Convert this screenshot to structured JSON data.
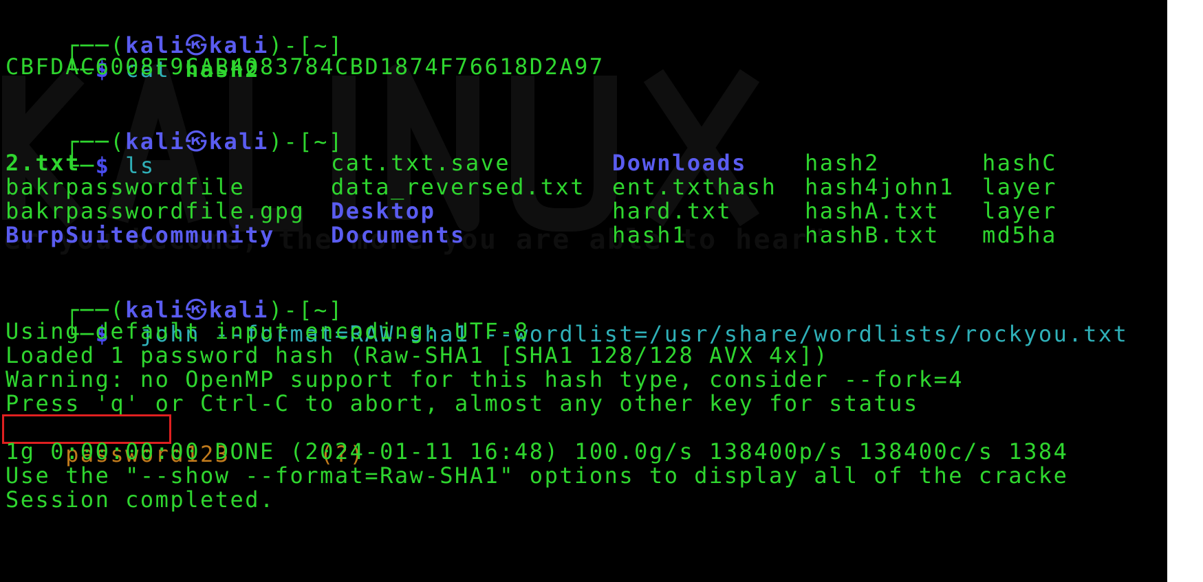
{
  "terminal": {
    "background": "#000000",
    "text_color": "#2fd62f",
    "accent_color": "#5a5cf0",
    "highlight_color": "#e02020",
    "cracked_color": "#c07a1c"
  },
  "prompt": {
    "frame_top": "┌──(",
    "user": "kali",
    "at_icon": "㉿",
    "host": "kali",
    "dir_part": ")-[~]",
    "frame_bottom": "└─",
    "dollar": "$"
  },
  "block1": {
    "cmd": "cat",
    "arg": "hash2",
    "output": "CBFDAC6008F9CAB4083784CBD1874F76618D2A97"
  },
  "block2": {
    "cmd": "ls",
    "columns": [
      [
        "2.txt",
        "bakrpasswordfile",
        "bakrpasswordfile.gpg",
        "BurpSuiteCommunity"
      ],
      [
        "cat.txt.save",
        "data_reversed.txt",
        "Desktop",
        "Documents"
      ],
      [
        "Downloads",
        "ent.txthash",
        "hard.txt",
        "hash1"
      ],
      [
        "hash2",
        "hash4john1",
        "hashA.txt",
        "hashB.txt"
      ],
      [
        "hashC",
        "layer",
        "layer",
        "md5ha"
      ]
    ]
  },
  "block3": {
    "cmd": " john --format=RAW-sha1 --wordlist=/usr/share/wordlists/rockyou.txt",
    "output_lines": [
      "Using default input encoding: UTF-8",
      "Loaded 1 password hash (Raw-SHA1 [SHA1 128/128 AVX 4x])",
      "Warning: no OpenMP support for this hash type, consider --fork=4",
      "Press 'q' or Ctrl-C to abort, almost any other key for status"
    ],
    "cracked_password": "password123",
    "cracked_suffix": "      (?)",
    "after_lines": [
      "1g 0:00:00:00 DONE (2024-01-11 16:48) 100.0g/s 138400p/s 138400c/s 1384",
      "Use the \"--show --format=Raw-SHA1\" options to display all of the cracke",
      "Session completed."
    ]
  },
  "watermark_text": "\"the quieter you become, the more you are able to hear\""
}
